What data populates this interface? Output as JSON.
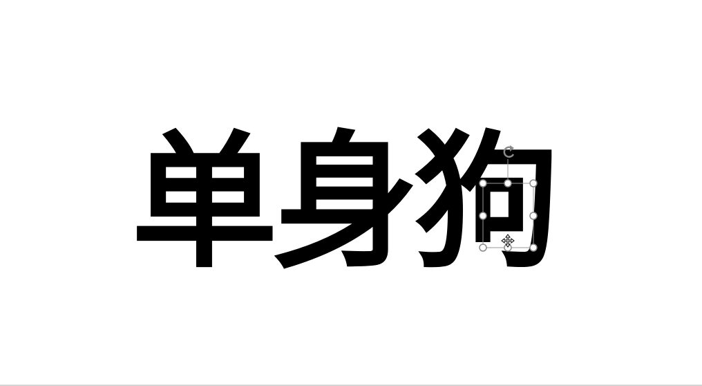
{
  "slide": {
    "text_box_content": "单身狗"
  },
  "selection": {
    "target": "shape-segment",
    "handles": [
      "top-left",
      "top-center",
      "top-right",
      "middle-left",
      "middle-right",
      "bottom-left",
      "bottom-center",
      "bottom-right"
    ],
    "rotate_handle_icon": "rotate-icon",
    "move_cursor_icon": "move-cursor-icon"
  },
  "colors": {
    "background": "#ffffff",
    "text": "#000000",
    "handle_stroke": "#8a8a8a",
    "handle_fill": "#ffffff",
    "divider": "#d4d4d4"
  }
}
